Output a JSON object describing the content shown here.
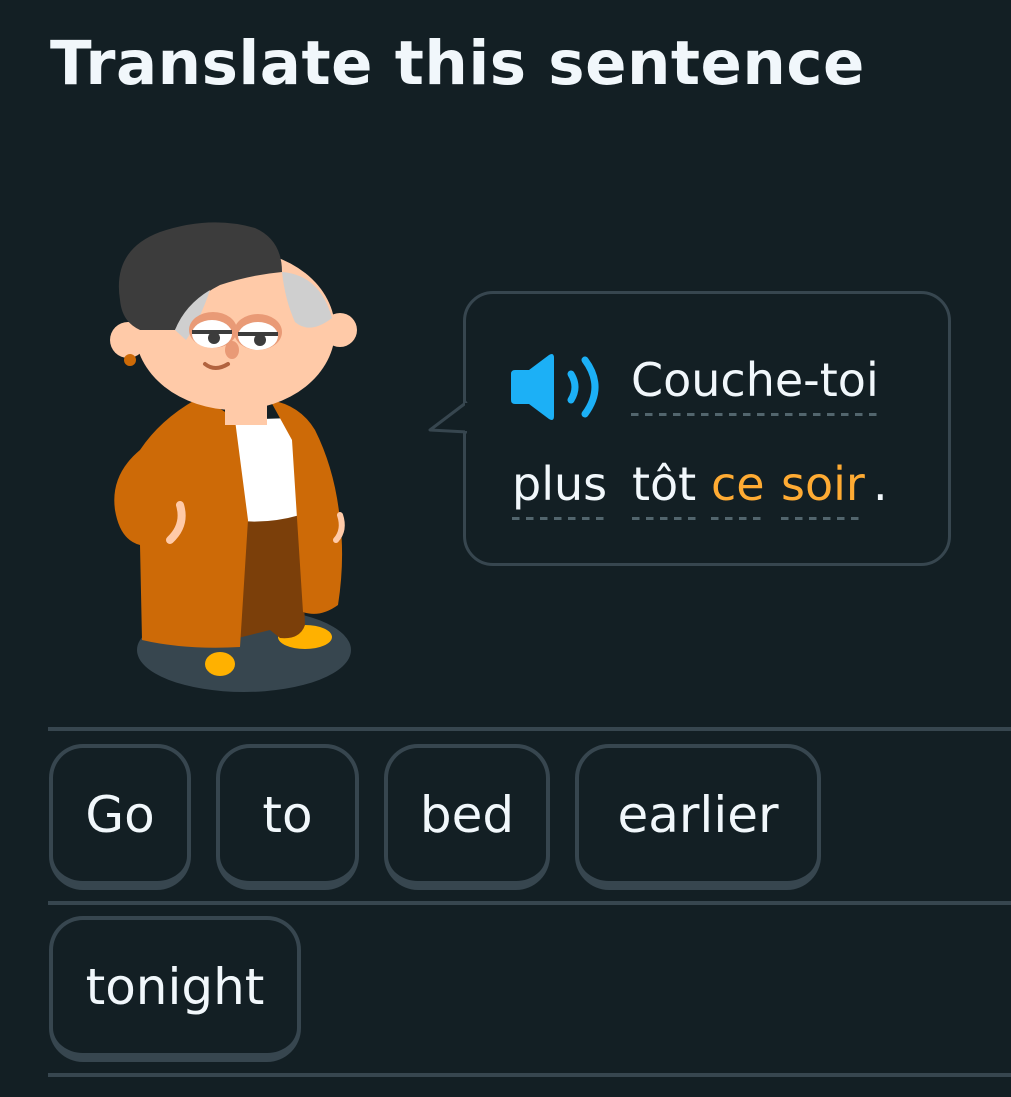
{
  "header": {
    "title": "Translate this sentence"
  },
  "prompt": {
    "speaker_icon": "speaker-icon",
    "sentence_words": [
      {
        "text": "Couche-toi",
        "highlighted": false
      },
      {
        "text": "plus",
        "highlighted": false
      },
      {
        "text": "tôt",
        "highlighted": false
      },
      {
        "text": "ce",
        "highlighted": true
      },
      {
        "text": "soir",
        "highlighted": true
      }
    ],
    "final_punctuation": "."
  },
  "word_bank": {
    "words": [
      "Go",
      "to",
      "bed",
      "earlier",
      "tonight"
    ]
  },
  "colors": {
    "background": "#131f24",
    "border": "#37464f",
    "text": "#f1f7fb",
    "highlight": "#ffab33",
    "speaker": "#1cb0f6"
  }
}
